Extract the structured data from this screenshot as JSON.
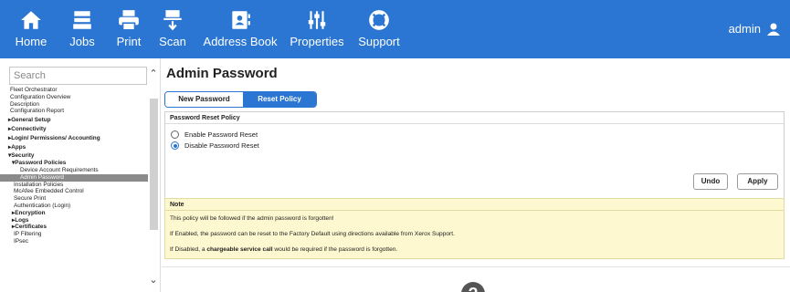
{
  "topnav": {
    "items": [
      {
        "label": "Home",
        "icon": "home-icon"
      },
      {
        "label": "Jobs",
        "icon": "jobs-icon"
      },
      {
        "label": "Print",
        "icon": "print-icon"
      },
      {
        "label": "Scan",
        "icon": "scan-icon"
      },
      {
        "label": "Address Book",
        "icon": "address-book-icon"
      },
      {
        "label": "Properties",
        "icon": "properties-icon"
      },
      {
        "label": "Support",
        "icon": "support-icon"
      }
    ],
    "user": "admin",
    "user_icon": "user-icon",
    "accent_color": "#2a76d2"
  },
  "sidebar": {
    "search_placeholder": "Search",
    "items": [
      {
        "label": "Fleet Orchestrator"
      },
      {
        "label": "Configuration Overview"
      },
      {
        "label": "Description"
      },
      {
        "label": "Configuration Report"
      },
      {
        "label": "▸General Setup"
      },
      {
        "label": "▸Connectivity"
      },
      {
        "label": "▸Login/ Permissions/ Accounting"
      },
      {
        "label": "▸Apps"
      },
      {
        "label": "▾Security"
      },
      {
        "label": "▾Password Policies"
      },
      {
        "label": "Device Account Requirements"
      },
      {
        "label": "Admin Password"
      },
      {
        "label": "Installation Policies"
      },
      {
        "label": "McAfee Embedded Control"
      },
      {
        "label": "Secure Print"
      },
      {
        "label": "Authentication (Login)"
      },
      {
        "label": "▸Encryption"
      },
      {
        "label": "▸Logs"
      },
      {
        "label": "▸Certificates"
      },
      {
        "label": "IP Filtering"
      },
      {
        "label": "IPsec"
      }
    ],
    "active_item": "Admin Password"
  },
  "main": {
    "title": "Admin Password",
    "tabs": [
      {
        "label": "New Password",
        "active": false
      },
      {
        "label": "Reset Policy",
        "active": true
      }
    ],
    "panel": {
      "header": "Password Reset Policy",
      "options": [
        {
          "label": "Enable Password Reset",
          "checked": false
        },
        {
          "label": "Disable Password Reset",
          "checked": true
        }
      ]
    },
    "buttons": {
      "undo": "Undo",
      "apply": "Apply"
    },
    "note": {
      "title": "Note",
      "line1": "This policy will be followed if the admin password is forgotten!",
      "line2": "If Enabled, the password can be reset to the Factory Default using directions available from Xerox Support.",
      "line3_pre": "If Disabled, a ",
      "line3_bold": "chargeable service call",
      "line3_post": " would be required if the password is forgotten."
    },
    "help_icon": "help-icon",
    "help_glyph": "?"
  }
}
